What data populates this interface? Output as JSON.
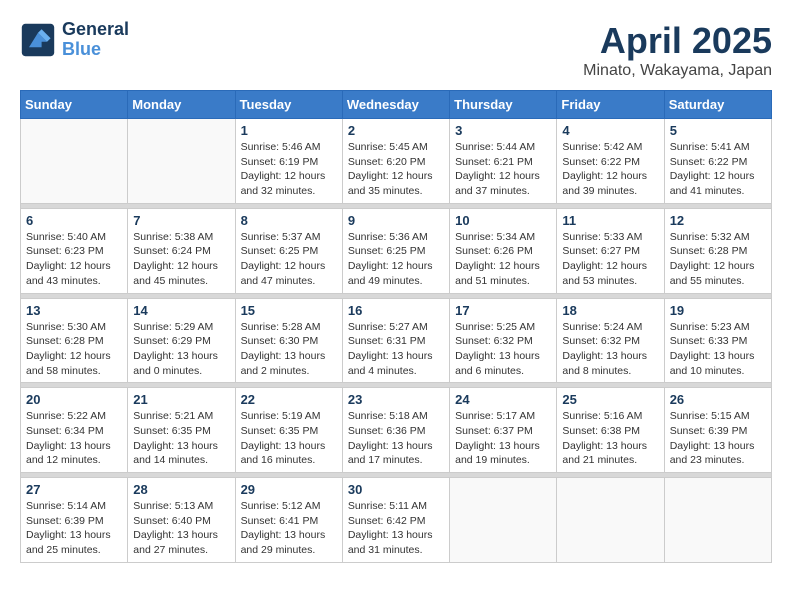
{
  "header": {
    "logo_line1": "General",
    "logo_line2": "Blue",
    "month": "April 2025",
    "location": "Minato, Wakayama, Japan"
  },
  "weekdays": [
    "Sunday",
    "Monday",
    "Tuesday",
    "Wednesday",
    "Thursday",
    "Friday",
    "Saturday"
  ],
  "weeks": [
    [
      {
        "day": "",
        "info": ""
      },
      {
        "day": "",
        "info": ""
      },
      {
        "day": "1",
        "info": "Sunrise: 5:46 AM\nSunset: 6:19 PM\nDaylight: 12 hours\nand 32 minutes."
      },
      {
        "day": "2",
        "info": "Sunrise: 5:45 AM\nSunset: 6:20 PM\nDaylight: 12 hours\nand 35 minutes."
      },
      {
        "day": "3",
        "info": "Sunrise: 5:44 AM\nSunset: 6:21 PM\nDaylight: 12 hours\nand 37 minutes."
      },
      {
        "day": "4",
        "info": "Sunrise: 5:42 AM\nSunset: 6:22 PM\nDaylight: 12 hours\nand 39 minutes."
      },
      {
        "day": "5",
        "info": "Sunrise: 5:41 AM\nSunset: 6:22 PM\nDaylight: 12 hours\nand 41 minutes."
      }
    ],
    [
      {
        "day": "6",
        "info": "Sunrise: 5:40 AM\nSunset: 6:23 PM\nDaylight: 12 hours\nand 43 minutes."
      },
      {
        "day": "7",
        "info": "Sunrise: 5:38 AM\nSunset: 6:24 PM\nDaylight: 12 hours\nand 45 minutes."
      },
      {
        "day": "8",
        "info": "Sunrise: 5:37 AM\nSunset: 6:25 PM\nDaylight: 12 hours\nand 47 minutes."
      },
      {
        "day": "9",
        "info": "Sunrise: 5:36 AM\nSunset: 6:25 PM\nDaylight: 12 hours\nand 49 minutes."
      },
      {
        "day": "10",
        "info": "Sunrise: 5:34 AM\nSunset: 6:26 PM\nDaylight: 12 hours\nand 51 minutes."
      },
      {
        "day": "11",
        "info": "Sunrise: 5:33 AM\nSunset: 6:27 PM\nDaylight: 12 hours\nand 53 minutes."
      },
      {
        "day": "12",
        "info": "Sunrise: 5:32 AM\nSunset: 6:28 PM\nDaylight: 12 hours\nand 55 minutes."
      }
    ],
    [
      {
        "day": "13",
        "info": "Sunrise: 5:30 AM\nSunset: 6:28 PM\nDaylight: 12 hours\nand 58 minutes."
      },
      {
        "day": "14",
        "info": "Sunrise: 5:29 AM\nSunset: 6:29 PM\nDaylight: 13 hours\nand 0 minutes."
      },
      {
        "day": "15",
        "info": "Sunrise: 5:28 AM\nSunset: 6:30 PM\nDaylight: 13 hours\nand 2 minutes."
      },
      {
        "day": "16",
        "info": "Sunrise: 5:27 AM\nSunset: 6:31 PM\nDaylight: 13 hours\nand 4 minutes."
      },
      {
        "day": "17",
        "info": "Sunrise: 5:25 AM\nSunset: 6:32 PM\nDaylight: 13 hours\nand 6 minutes."
      },
      {
        "day": "18",
        "info": "Sunrise: 5:24 AM\nSunset: 6:32 PM\nDaylight: 13 hours\nand 8 minutes."
      },
      {
        "day": "19",
        "info": "Sunrise: 5:23 AM\nSunset: 6:33 PM\nDaylight: 13 hours\nand 10 minutes."
      }
    ],
    [
      {
        "day": "20",
        "info": "Sunrise: 5:22 AM\nSunset: 6:34 PM\nDaylight: 13 hours\nand 12 minutes."
      },
      {
        "day": "21",
        "info": "Sunrise: 5:21 AM\nSunset: 6:35 PM\nDaylight: 13 hours\nand 14 minutes."
      },
      {
        "day": "22",
        "info": "Sunrise: 5:19 AM\nSunset: 6:35 PM\nDaylight: 13 hours\nand 16 minutes."
      },
      {
        "day": "23",
        "info": "Sunrise: 5:18 AM\nSunset: 6:36 PM\nDaylight: 13 hours\nand 17 minutes."
      },
      {
        "day": "24",
        "info": "Sunrise: 5:17 AM\nSunset: 6:37 PM\nDaylight: 13 hours\nand 19 minutes."
      },
      {
        "day": "25",
        "info": "Sunrise: 5:16 AM\nSunset: 6:38 PM\nDaylight: 13 hours\nand 21 minutes."
      },
      {
        "day": "26",
        "info": "Sunrise: 5:15 AM\nSunset: 6:39 PM\nDaylight: 13 hours\nand 23 minutes."
      }
    ],
    [
      {
        "day": "27",
        "info": "Sunrise: 5:14 AM\nSunset: 6:39 PM\nDaylight: 13 hours\nand 25 minutes."
      },
      {
        "day": "28",
        "info": "Sunrise: 5:13 AM\nSunset: 6:40 PM\nDaylight: 13 hours\nand 27 minutes."
      },
      {
        "day": "29",
        "info": "Sunrise: 5:12 AM\nSunset: 6:41 PM\nDaylight: 13 hours\nand 29 minutes."
      },
      {
        "day": "30",
        "info": "Sunrise: 5:11 AM\nSunset: 6:42 PM\nDaylight: 13 hours\nand 31 minutes."
      },
      {
        "day": "",
        "info": ""
      },
      {
        "day": "",
        "info": ""
      },
      {
        "day": "",
        "info": ""
      }
    ]
  ]
}
